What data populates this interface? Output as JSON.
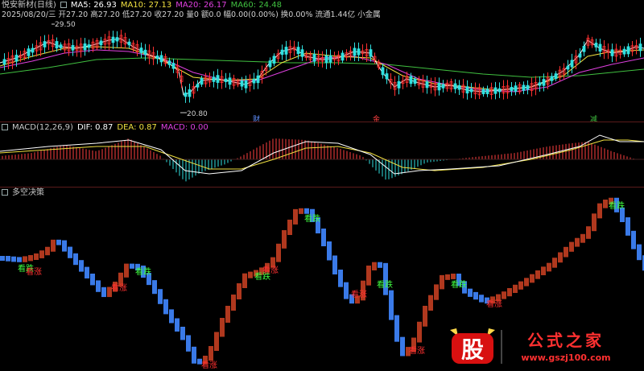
{
  "price_panel": {
    "title": "悦安新材(日线)",
    "ma5_label": "MA5: 26.93",
    "ma10_label": "MA10: 27.13",
    "ma20_label": "MA20: 26.17",
    "ma60_label": "MA60: 24.48",
    "info_line": "2025/08/20/三 开27.20 高27.20 低27.20 收27.20 量0 额0.0 幅0.00(0.00%) 换0.00% 流通1.44亿 小金属",
    "high_marker": "29.50",
    "low_marker": "20.80",
    "event_cai": "财",
    "event_jin": "金",
    "event_jian": "减",
    "colors": {
      "ma5": "#ffffff",
      "ma10": "#f0e040",
      "ma20": "#e040e0",
      "ma60": "#40c040",
      "up": "#ff3030",
      "down": "#30e0e0"
    }
  },
  "macd_panel": {
    "title": "MACD(12,26,9)",
    "dif_label": "DIF: 0.87",
    "dea_label": "DEA: 0.87",
    "macd_label": "MACD: 0.00"
  },
  "decision_panel": {
    "title": "多空决策",
    "rise_label": "看涨",
    "fall_label": "看跌",
    "colors": {
      "rise": "#b0381e",
      "fall": "#3a7ae8"
    }
  },
  "watermark": {
    "logo_char": "股",
    "site_name": "公式之家",
    "url": "www.gszj100.com"
  }
}
